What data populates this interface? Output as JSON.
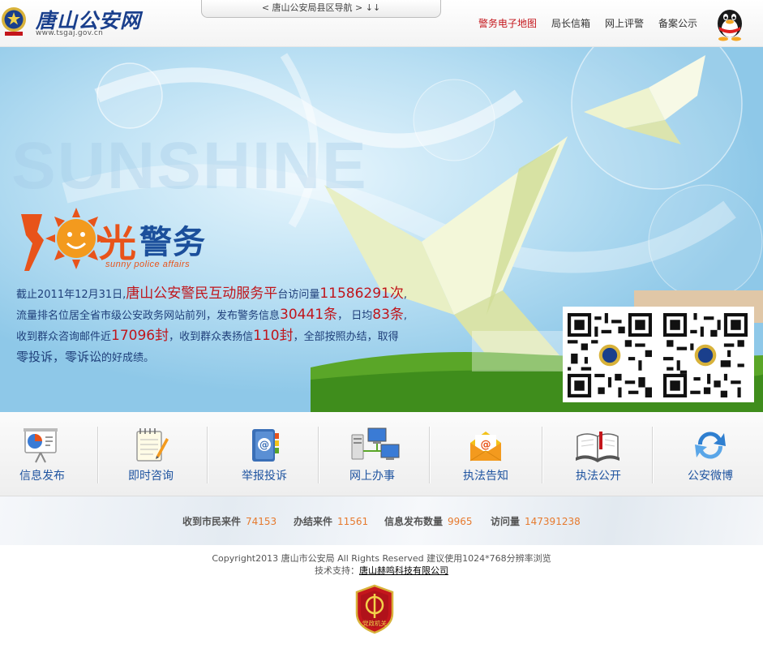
{
  "header": {
    "logo_text": "唐山公安网",
    "logo_url": "www.tsgaj.gov.cn",
    "county_nav": "< 唐山公安局县区导航 > ↓↓",
    "nav": [
      {
        "label": "警务电子地图"
      },
      {
        "label": "局长信箱"
      },
      {
        "label": "网上评警"
      },
      {
        "label": "备案公示"
      }
    ]
  },
  "banner": {
    "watermark": "SUNSHINE",
    "brand_main": "光",
    "brand_jingwu": "警务",
    "brand_sub": "sunny police affairs",
    "stats": {
      "line1_a": "截止2011年12月31日,",
      "line1_b": "唐山公安警民互动服务平",
      "line1_c": "台访问量",
      "line1_d": "11586291次",
      "line1_e": ",",
      "line2_a": "流量排名位居全省市级公安政务网站前列，发布警务信息",
      "line2_b": "30441条",
      "line2_c": "， 日均",
      "line2_d": "83条",
      "line2_e": ",",
      "line3_a": "收到群众咨询邮件近",
      "line3_b": "17096封",
      "line3_c": "，收到群众表扬信",
      "line3_d": "110封",
      "line3_e": "，全部按照办结，取得",
      "line4_a": "零投诉，零诉讼",
      "line4_b": "的好成绩。"
    }
  },
  "services": [
    {
      "label": "信息发布",
      "icon": "presentation-chart-icon"
    },
    {
      "label": "即时咨询",
      "icon": "notepad-pen-icon"
    },
    {
      "label": "举报投诉",
      "icon": "address-book-icon"
    },
    {
      "label": "网上办事",
      "icon": "computers-network-icon"
    },
    {
      "label": "执法告知",
      "icon": "envelope-at-icon"
    },
    {
      "label": "执法公开",
      "icon": "open-book-icon"
    },
    {
      "label": "公安微博",
      "icon": "refresh-arrows-icon"
    }
  ],
  "counters": [
    {
      "label": "收到市民来件",
      "value": "74153"
    },
    {
      "label": "办结来件",
      "value": "11561"
    },
    {
      "label": "信息发布数量",
      "value": "9965"
    },
    {
      "label": "访问量",
      "value": "147391238"
    }
  ],
  "footer": {
    "copyright": "Copyright2013 唐山市公安局 All Rights Reserved 建议使用1024*768分辨率浏览",
    "tech_support_label": "技术支持：",
    "tech_support_company": "唐山赫鸣科技有限公司",
    "badge_text": "党政机关"
  },
  "colors": {
    "brand_blue": "#1b4f9b",
    "highlight_red": "#c0151b",
    "nav_active": "#c4161c",
    "counter_orange": "#e67a2e"
  }
}
